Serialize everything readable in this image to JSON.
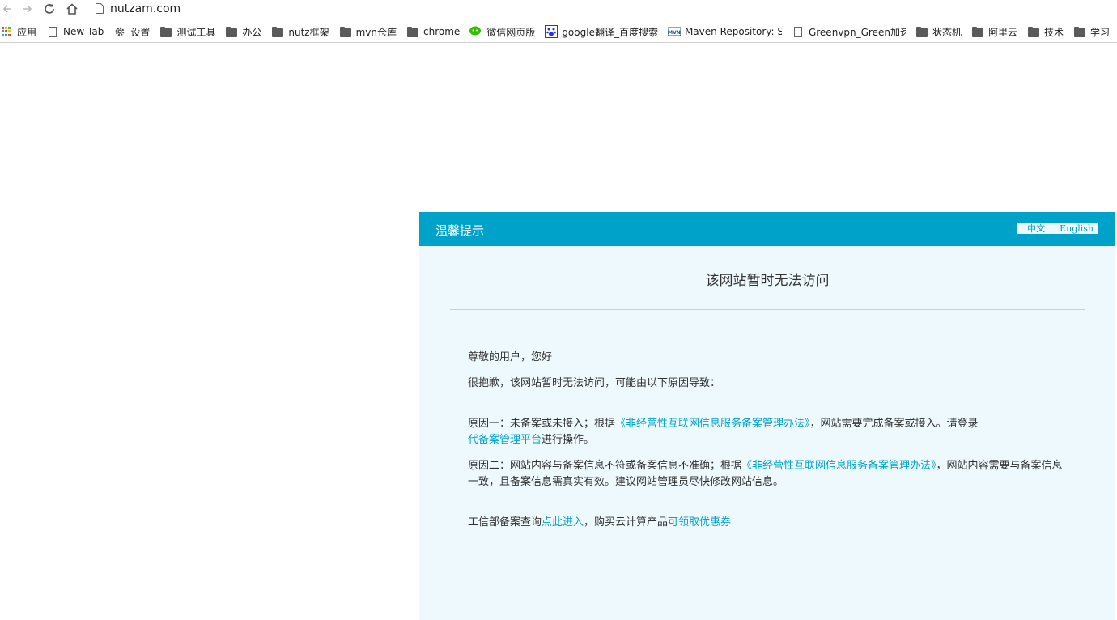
{
  "browser": {
    "url": "nutzam.com",
    "bookmarks": [
      {
        "label": "应用",
        "icon": "apps-grid-icon"
      },
      {
        "label": "New Tab",
        "icon": "page-icon"
      },
      {
        "label": "设置",
        "icon": "gear-icon"
      },
      {
        "label": "测试工具",
        "icon": "folder-icon"
      },
      {
        "label": "办公",
        "icon": "folder-icon"
      },
      {
        "label": "nutz框架",
        "icon": "folder-icon"
      },
      {
        "label": "mvn仓库",
        "icon": "folder-icon"
      },
      {
        "label": "chrome",
        "icon": "folder-icon"
      },
      {
        "label": "微信网页版",
        "icon": "wechat-icon"
      },
      {
        "label": "google翻译_百度搜索",
        "icon": "baidu-paw-icon"
      },
      {
        "label": "Maven Repository: S",
        "icon": "mvn-icon"
      },
      {
        "label": "Greenvpn_Green加速",
        "icon": "page-icon"
      },
      {
        "label": "状态机",
        "icon": "folder-icon"
      },
      {
        "label": "阿里云",
        "icon": "folder-icon"
      },
      {
        "label": "技术",
        "icon": "folder-icon"
      },
      {
        "label": "学习",
        "icon": "folder-icon"
      }
    ]
  },
  "notice": {
    "header_title": "温馨提示",
    "lang_zh": "中文",
    "lang_en": "English",
    "heading": "该网站暂时无法访问",
    "greeting": "尊敬的用户，您好",
    "intro": "很抱歉，该网站暂时无法访问，可能由以下原因导致：",
    "reason1_prefix": "原因一：未备案或未接入；根据",
    "reason1_link": "《非经营性互联网信息服务备案管理办法》",
    "reason1_mid": "，网站需要完成备案或接入。请登录",
    "reason1_link2": "代备案管理平台",
    "reason1_suffix": "进行操作。",
    "reason2_prefix": "原因二：网站内容与备案信息不符或备案信息不准确；根据",
    "reason2_link": "《非经营性互联网信息服务备案管理办法》",
    "reason2_suffix": "，网站内容需要与备案信息一致，且备案信息需真实有效。建议网站管理员尽快修改网站信息。",
    "footer_prefix": "工信部备案查询",
    "footer_link1": "点此进入",
    "footer_mid": "，购买云计算产品",
    "footer_link2": "可领取优惠券"
  },
  "colors": {
    "accent": "#00a2ca",
    "panel_bg": "#eef9fd"
  }
}
